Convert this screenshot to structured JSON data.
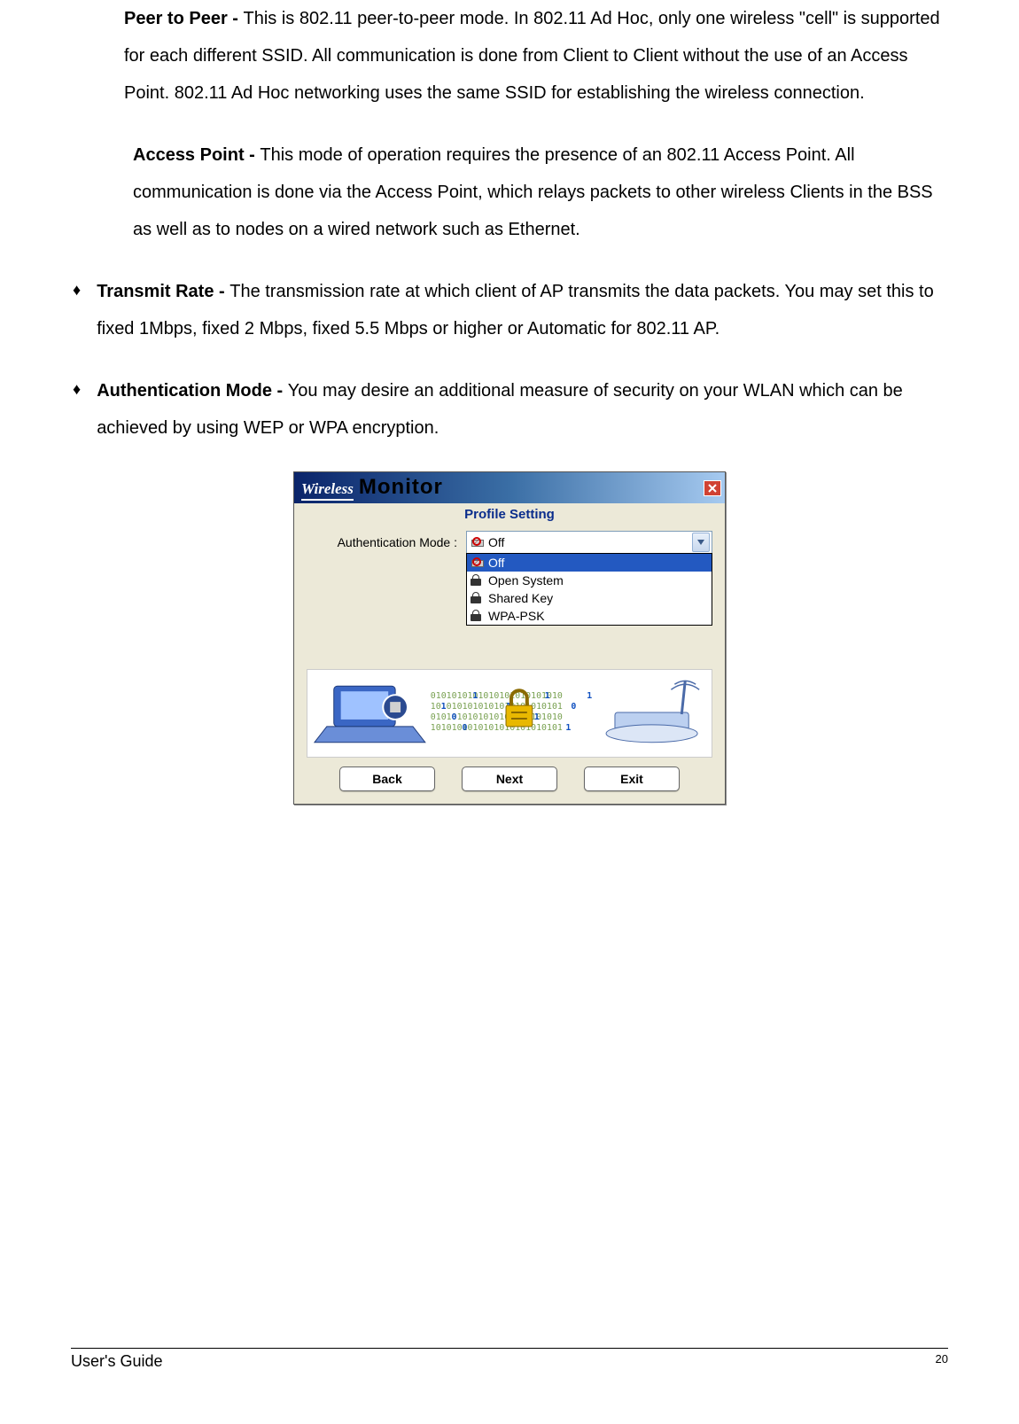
{
  "paras": {
    "p1_bold": "Peer to Peer   - ",
    "p1_rest": "This is 802.11 peer-to-peer mode. In 802.11 Ad Hoc, only one wireless \"cell\" is supported for each different SSID. All communication is done from Client to Client without the use of an Access Point. 802.11 Ad Hoc networking uses the same SSID for establishing the wireless connection.",
    "p2_bold": "Access Point  - ",
    "p2_rest": "This mode of operation requires the presence of an 802.11 Access Point. All communication is done via the Access Point, which relays packets to other wireless Clients in the BSS as well as to nodes on a wired network such as Ethernet.",
    "b1_bold": "Transmit Rate - ",
    "b1_rest": "The transmission rate at which client of AP transmits the data packets. You may set this to fixed 1Mbps, fixed 2 Mbps, fixed 5.5 Mbps or higher or Automatic for 802.11 AP.",
    "b2_bold": "Authentication Mode - ",
    "b2_rest": "You may desire an additional measure of security on your WLAN which can be achieved by using WEP or WPA encryption."
  },
  "dialog": {
    "brand_w": "Wireless",
    "brand_m": "Monitor",
    "section": "Profile Setting",
    "field_label": "Authentication Mode :",
    "selected": "Off",
    "options": [
      "Off",
      "Open System",
      "Shared Key",
      "WPA-PSK"
    ],
    "buttons": {
      "back": "Back",
      "next": "Next",
      "exit": "Exit"
    }
  },
  "footer": {
    "guide": "User's Guide",
    "page": "20"
  },
  "bullet": "♦"
}
